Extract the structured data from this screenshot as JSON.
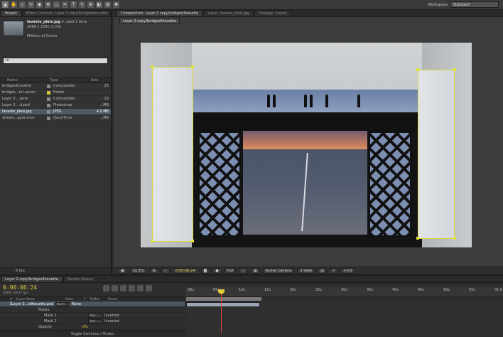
{
  "app": {
    "workspace_label": "Workspace",
    "workspace_value": "Standard",
    "tool_icons": [
      "selection-tool-icon",
      "hand-tool-icon",
      "zoom-tool-icon",
      "rotate-tool-icon",
      "camera-tool-icon",
      "pan-behind-tool-icon",
      "mask-tool-icon",
      "pen-tool-icon",
      "text-tool-icon",
      "brush-tool-icon",
      "clone-stamp-tool-icon",
      "eraser-tool-icon",
      "roto-brush-tool-icon",
      "puppet-tool-icon"
    ]
  },
  "project_panel": {
    "tabs": [
      "Project",
      "Effect Controls: Layer 2 copy/bridgesilhouette"
    ],
    "selected_name": "lavaste_plais.jpg ▾",
    "used": ", used 1 time",
    "dimensions": "3888 x 2592 (1.00)",
    "colors": "Millions of Colors",
    "search_placeholder": "⌕▾",
    "columns": [
      "Name",
      "Type",
      "Size"
    ],
    "items": [
      {
        "name": "bridgesilhouette",
        "type": "Composition",
        "size": "25",
        "label_color": "#8a8a8a",
        "selected": false
      },
      {
        "name": "bridges...te Layers",
        "type": "Folder",
        "size": "",
        "label_color": "#d9c441",
        "selected": false
      },
      {
        "name": "Layer 2 ...ame",
        "type": "Composition",
        "size": "29",
        "label_color": "#8a8a8a",
        "selected": false
      },
      {
        "name": "Layer 2....d.psd",
        "type": "Photoshop",
        "size": "...MB",
        "label_color": "#8a8a8a",
        "selected": false
      },
      {
        "name": "lavaste_plais.jpg",
        "type": "JPEG",
        "size": "4.0 MB",
        "label_color": "#8a8a8a",
        "selected": true
      },
      {
        "name": "streett...apse.mov",
        "type": "QuickTime",
        "size": "...MB",
        "label_color": "#8a8a8a",
        "selected": false
      }
    ],
    "footer_bpc": "8 bpc"
  },
  "viewer": {
    "tabs": [
      "Composition: Layer 2 copy/bridgesilhouette",
      "Layer: lavaste_plais.jpg",
      "Footage: (none)"
    ],
    "subtab": "Layer 2 copy/bridgesilhouette",
    "zoom": "32.5%",
    "timecode": "0:00:06:24",
    "resolution": "Full",
    "camera": "Active Camera",
    "views": "1 View",
    "exposure": "+0.0"
  },
  "timeline": {
    "tabs": [
      "Layer 2 copy/bridgesilhouette",
      "Render Queue"
    ],
    "current_time": "0:00:06:24",
    "frames": "00204 (29.97 fps)",
    "columns": [
      "#",
      "Source Name",
      "Mode",
      "T",
      "TrkMat",
      "Parent"
    ],
    "layers": [
      {
        "name": "Layer 2...silhouette.psd",
        "mode": "Norm",
        "parent": "None",
        "selected": true,
        "num": "1"
      },
      {
        "name": "Masks",
        "mode": "",
        "parent": "",
        "selected": false,
        "num": ""
      },
      {
        "name": "Mask 1",
        "mode": "Add",
        "parent": "Inverted",
        "selected": false,
        "num": ""
      },
      {
        "name": "Mask 2",
        "mode": "Add",
        "parent": "Inverted",
        "selected": false,
        "num": ""
      },
      {
        "name": "Opacity",
        "mode": "",
        "parent": "",
        "value": "0%",
        "selected": false,
        "num": ""
      }
    ],
    "ruler_ticks": [
      "00s",
      "05s",
      "10s",
      "15s",
      "20s",
      "25s",
      "30s",
      "35s",
      "40s",
      "45s",
      "50s",
      "55s",
      "01:0"
    ],
    "footer": "Toggle Switches / Modes"
  }
}
